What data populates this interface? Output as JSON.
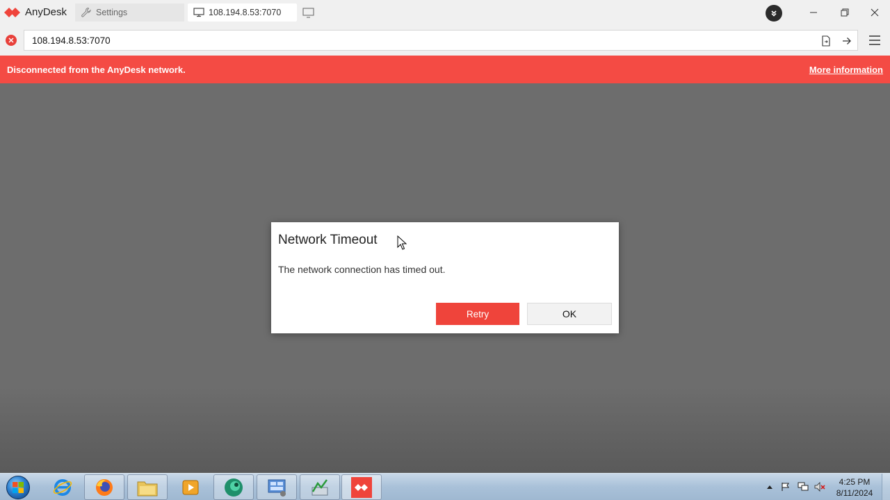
{
  "app": {
    "name": "AnyDesk",
    "brand_color": "#ef443b"
  },
  "tabs": [
    {
      "label": "Settings",
      "icon": "wrench-icon"
    },
    {
      "label": "108.194.8.53:7070",
      "icon": "monitor-icon"
    }
  ],
  "address_bar": {
    "value": "108.194.8.53:7070",
    "status_icon": "error-x-icon"
  },
  "banner": {
    "text": "Disconnected from the AnyDesk network.",
    "link": "More information",
    "color": "#f44b44"
  },
  "dialog": {
    "title": "Network Timeout",
    "message": "The network connection has timed out.",
    "retry_label": "Retry",
    "ok_label": "OK"
  },
  "taskbar": {
    "items": [
      {
        "icon": "internet-explorer-icon"
      },
      {
        "icon": "firefox-icon"
      },
      {
        "icon": "file-explorer-icon"
      },
      {
        "icon": "media-player-icon"
      },
      {
        "icon": "green-circle-app-icon"
      },
      {
        "icon": "control-panel-icon"
      },
      {
        "icon": "chart-app-icon"
      },
      {
        "icon": "anydesk-icon"
      }
    ],
    "clock": {
      "time": "4:25 PM",
      "date": "8/11/2024"
    }
  }
}
